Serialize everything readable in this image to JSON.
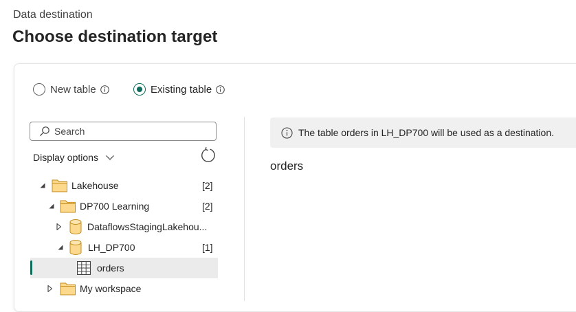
{
  "header": {
    "subtitle": "Data destination",
    "title": "Choose destination target"
  },
  "options": {
    "new_table_label": "New table",
    "existing_table_label": "Existing table",
    "selected": "Existing table"
  },
  "search": {
    "placeholder": "Search"
  },
  "display_options_label": "Display options",
  "tree": [
    {
      "label": "Lakehouse",
      "count": "[2]",
      "icon": "folder-icon",
      "expanded": true
    },
    {
      "label": "DP700 Learning",
      "count": "[2]",
      "icon": "folder-icon",
      "expanded": true
    },
    {
      "label": "DataflowsStagingLakehou...",
      "count": "",
      "icon": "lakehouse-cylinder-icon",
      "expanded": false
    },
    {
      "label": "LH_DP700",
      "count": "[1]",
      "icon": "lakehouse-cylinder-icon",
      "expanded": true
    },
    {
      "label": "orders",
      "count": "",
      "icon": "table-grid-icon",
      "selected": true
    },
    {
      "label": "My workspace",
      "count": "",
      "icon": "folder-icon",
      "expanded": false
    }
  ],
  "banner": {
    "text": "The table orders in LH_DP700 will be used as a destination."
  },
  "target_table": "orders",
  "colors": {
    "accent": "#0f6c5a",
    "folder_fill": "#fcd98d",
    "folder_stroke": "#c48c1b",
    "banner_bg": "#f0f0f0",
    "selected_row_bg": "#ebebeb"
  }
}
